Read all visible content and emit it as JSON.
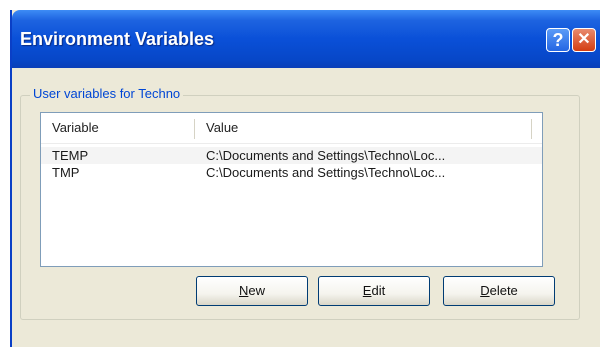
{
  "window": {
    "title": "Environment Variables",
    "help_glyph": "?",
    "close_glyph": "✕"
  },
  "user_group": {
    "label": "User variables for Techno",
    "columns": [
      "Variable",
      "Value"
    ],
    "rows": [
      {
        "variable": "TEMP",
        "value": "C:\\Documents and Settings\\Techno\\Loc..."
      },
      {
        "variable": "TMP",
        "value": "C:\\Documents and Settings\\Techno\\Loc..."
      }
    ]
  },
  "buttons": {
    "new": {
      "mnemonic": "N",
      "rest": "ew"
    },
    "edit": {
      "mnemonic": "E",
      "rest": "dit"
    },
    "delete": {
      "mnemonic": "D",
      "rest": "elete"
    }
  },
  "colors": {
    "titlebar": "#0a50d8",
    "group_label": "#0046d5",
    "dialog_bg": "#ece9d8"
  }
}
